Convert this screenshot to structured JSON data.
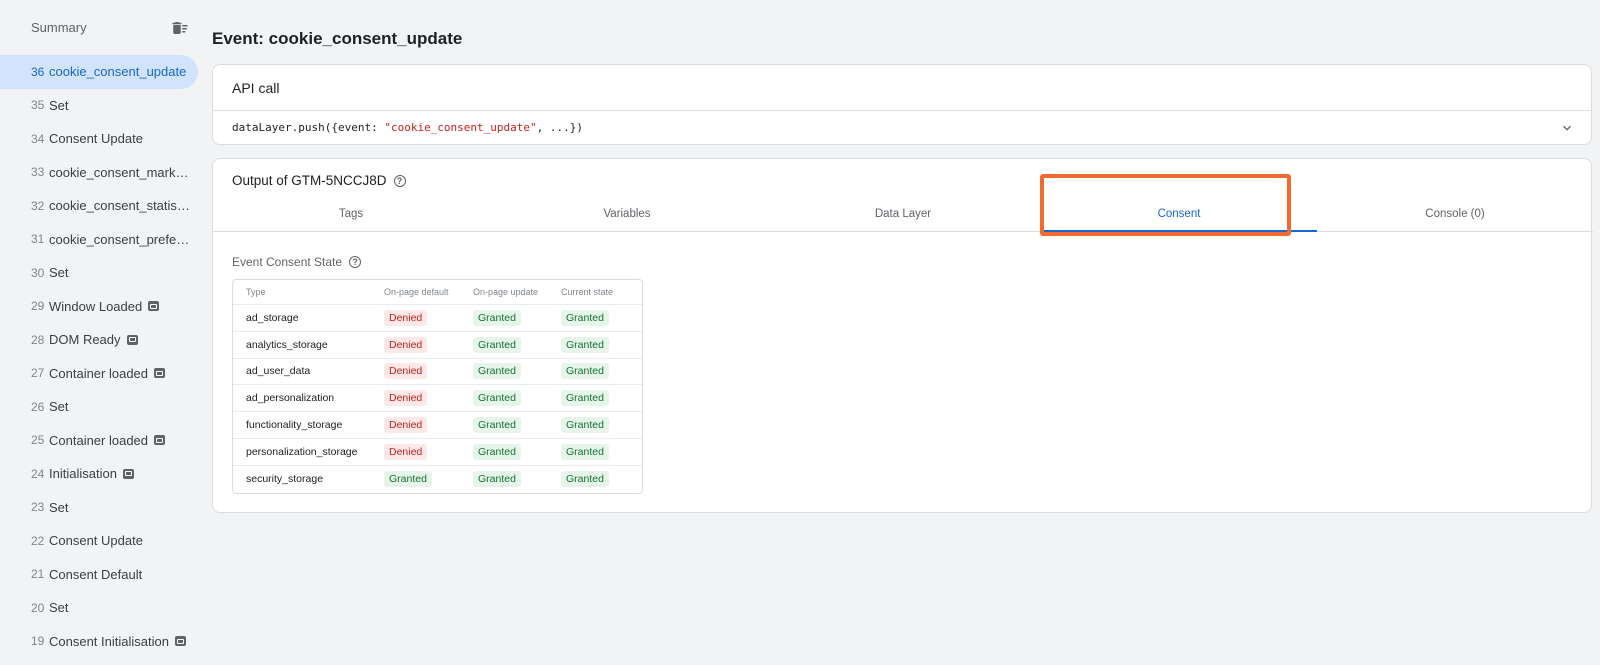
{
  "sidebar": {
    "title": "Summary",
    "clear_icon": "delete-sweep-icon",
    "items": [
      {
        "num": "36",
        "label": "cookie_consent_update",
        "active": true,
        "tag": false
      },
      {
        "num": "35",
        "label": "Set",
        "active": false,
        "tag": false
      },
      {
        "num": "34",
        "label": "Consent Update",
        "active": false,
        "tag": false
      },
      {
        "num": "33",
        "label": "cookie_consent_marketi...",
        "active": false,
        "tag": false
      },
      {
        "num": "32",
        "label": "cookie_consent_statistics",
        "active": false,
        "tag": false
      },
      {
        "num": "31",
        "label": "cookie_consent_prefere...",
        "active": false,
        "tag": false
      },
      {
        "num": "30",
        "label": "Set",
        "active": false,
        "tag": false
      },
      {
        "num": "29",
        "label": "Window Loaded",
        "active": false,
        "tag": true
      },
      {
        "num": "28",
        "label": "DOM Ready",
        "active": false,
        "tag": true
      },
      {
        "num": "27",
        "label": "Container loaded",
        "active": false,
        "tag": true
      },
      {
        "num": "26",
        "label": "Set",
        "active": false,
        "tag": false
      },
      {
        "num": "25",
        "label": "Container loaded",
        "active": false,
        "tag": true
      },
      {
        "num": "24",
        "label": "Initialisation",
        "active": false,
        "tag": true
      },
      {
        "num": "23",
        "label": "Set",
        "active": false,
        "tag": false
      },
      {
        "num": "22",
        "label": "Consent Update",
        "active": false,
        "tag": false
      },
      {
        "num": "21",
        "label": "Consent Default",
        "active": false,
        "tag": false
      },
      {
        "num": "20",
        "label": "Set",
        "active": false,
        "tag": false
      },
      {
        "num": "19",
        "label": "Consent Initialisation",
        "active": false,
        "tag": true
      }
    ]
  },
  "main": {
    "title": "Event: cookie_consent_update",
    "api": {
      "heading": "API call",
      "code_prefix": "dataLayer.push({event: ",
      "code_string": "\"cookie_consent_update\"",
      "code_suffix": ", ...})"
    },
    "output": {
      "heading": "Output of GTM-5NCCJ8D",
      "tabs": [
        "Tags",
        "Variables",
        "Data Layer",
        "Consent",
        "Console (0)"
      ],
      "active_tab": "Consent",
      "consent_heading": "Event Consent State",
      "columns": [
        "Type",
        "On-page default",
        "On-page update",
        "Current state"
      ],
      "rows": [
        {
          "type": "ad_storage",
          "default": "Denied",
          "update": "Granted",
          "current": "Granted"
        },
        {
          "type": "analytics_storage",
          "default": "Denied",
          "update": "Granted",
          "current": "Granted"
        },
        {
          "type": "ad_user_data",
          "default": "Denied",
          "update": "Granted",
          "current": "Granted"
        },
        {
          "type": "ad_personalization",
          "default": "Denied",
          "update": "Granted",
          "current": "Granted"
        },
        {
          "type": "functionality_storage",
          "default": "Denied",
          "update": "Granted",
          "current": "Granted"
        },
        {
          "type": "personalization_storage",
          "default": "Denied",
          "update": "Granted",
          "current": "Granted"
        },
        {
          "type": "security_storage",
          "default": "Granted",
          "update": "Granted",
          "current": "Granted"
        }
      ]
    }
  },
  "colors": {
    "accent": "#1967d2",
    "highlight": "#f26a2e",
    "denied_bg": "#fce8e6",
    "granted_bg": "#e6f4ea"
  }
}
